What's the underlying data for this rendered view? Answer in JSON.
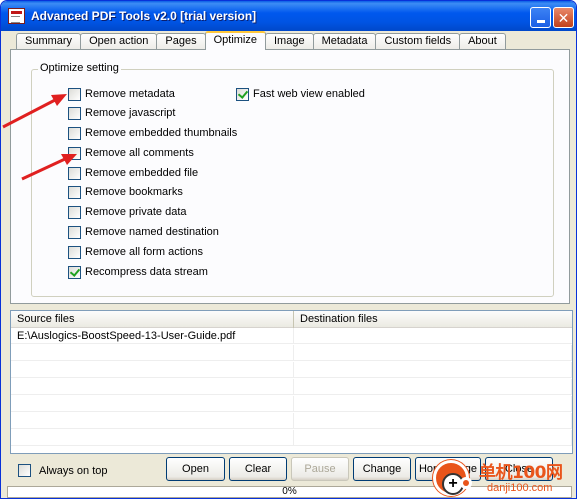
{
  "window": {
    "title": "Advanced PDF Tools  v2.0 [trial version]",
    "minimize_label": "",
    "close_label": "✕"
  },
  "tabs": [
    "Summary",
    "Open action",
    "Pages",
    "Optimize",
    "Image",
    "Metadata",
    "Custom fields",
    "About"
  ],
  "active_tab": "Optimize",
  "optimize": {
    "group_title": "Optimize setting",
    "options": [
      {
        "label": "Remove metadata",
        "checked": false
      },
      {
        "label": "Remove javascript",
        "checked": false
      },
      {
        "label": "Remove embedded thumbnails",
        "checked": false
      },
      {
        "label": "Remove all comments",
        "checked": false
      },
      {
        "label": "Remove embedded file",
        "checked": false
      },
      {
        "label": "Remove bookmarks",
        "checked": false
      },
      {
        "label": "Remove private data",
        "checked": false
      },
      {
        "label": "Remove named destination",
        "checked": false
      },
      {
        "label": "Remove all form actions",
        "checked": false
      },
      {
        "label": "Recompress data stream",
        "checked": true
      }
    ],
    "fast_web_view": {
      "label": "Fast web view enabled",
      "checked": true
    }
  },
  "annotations": {
    "arrow_color": "#e02020"
  },
  "file_list": {
    "columns": [
      "Source files",
      "Destination files"
    ],
    "rows": [
      {
        "source": "E:\\Auslogics-BoostSpeed-13-User-Guide.pdf",
        "destination": ""
      }
    ]
  },
  "bottom": {
    "always_on_top": {
      "label": "Always on top",
      "checked": false
    },
    "buttons": {
      "open": "Open",
      "clear": "Clear",
      "pause": "Pause",
      "change": "Change",
      "home_page": "Home Page",
      "close": "Close"
    }
  },
  "progress": {
    "value": 0,
    "text": "0%"
  },
  "watermark": {
    "text_cn": "单机100网",
    "text_url": "danji100.com"
  }
}
